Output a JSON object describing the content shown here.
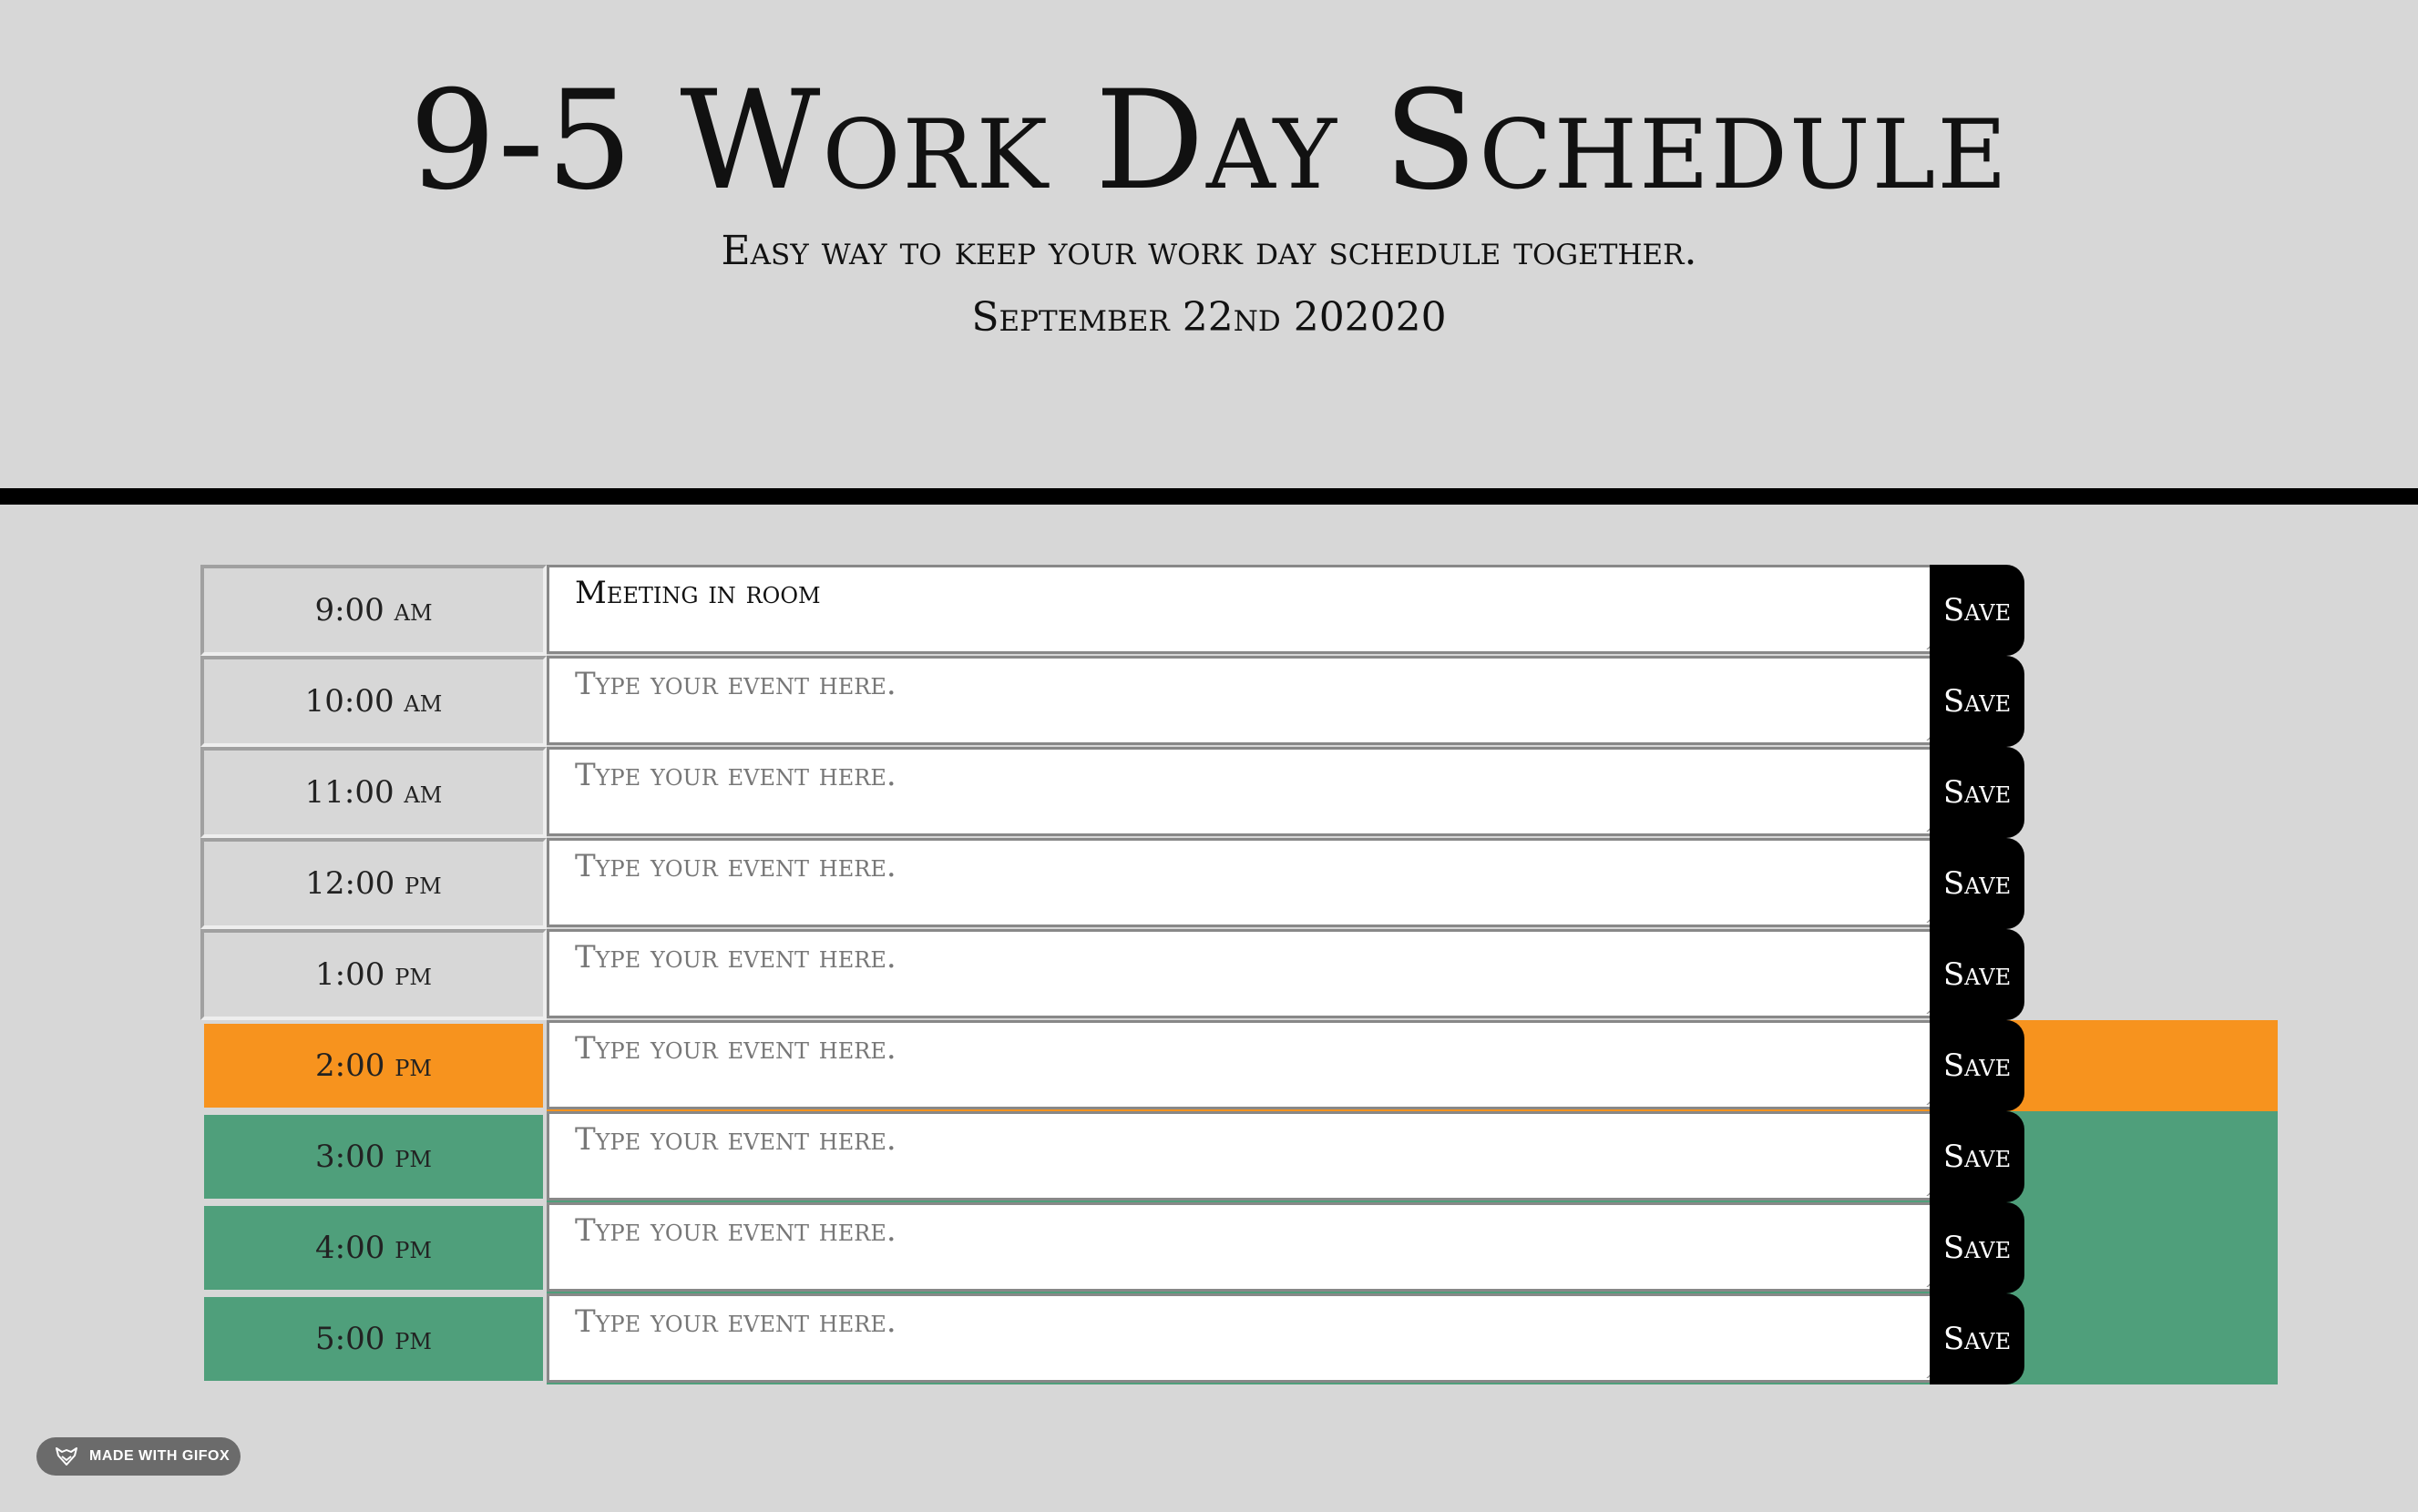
{
  "header": {
    "title": "9-5 Work Day Schedule",
    "lead": "Easy way to keep your work day schedule together.",
    "date": "September 22nd 202020"
  },
  "save_label": "Save",
  "placeholder": "Type your event here.",
  "colors": {
    "past": "#d7d7d7",
    "present": "#f7931e",
    "future": "#4f9f7b",
    "save": "#000000"
  },
  "rows": [
    {
      "hour": "9:00 am",
      "event": "Meeting in room",
      "state": "past"
    },
    {
      "hour": "10:00 am",
      "event": "",
      "state": "past"
    },
    {
      "hour": "11:00 am",
      "event": "",
      "state": "past"
    },
    {
      "hour": "12:00 pm",
      "event": "",
      "state": "past"
    },
    {
      "hour": "1:00 pm",
      "event": "",
      "state": "past"
    },
    {
      "hour": "2:00 pm",
      "event": "",
      "state": "present"
    },
    {
      "hour": "3:00 pm",
      "event": "",
      "state": "future"
    },
    {
      "hour": "4:00 pm",
      "event": "",
      "state": "future"
    },
    {
      "hour": "5:00 pm",
      "event": "",
      "state": "future"
    }
  ],
  "badge": {
    "label": "MADE WITH GIFOX",
    "icon": "fox-icon"
  }
}
